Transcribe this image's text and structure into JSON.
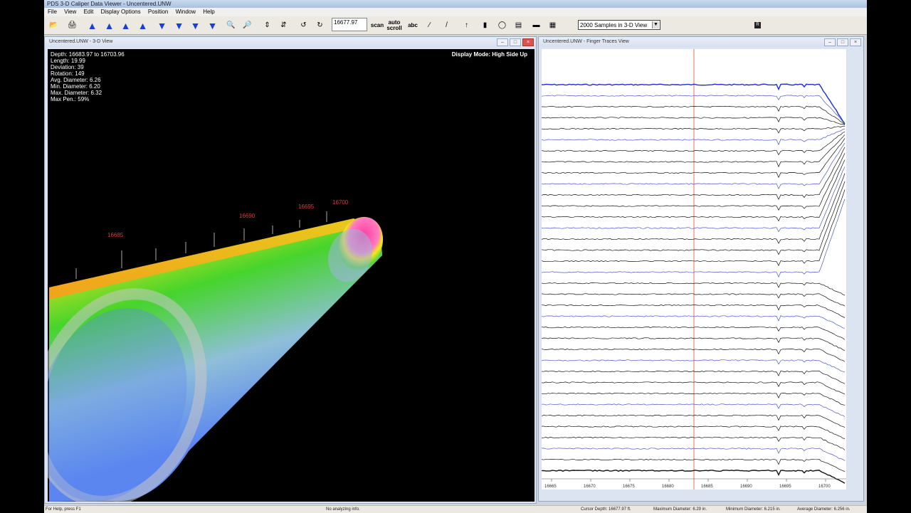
{
  "app": {
    "title": "PDS 3-D Caliper Data Viewer - Uncentered.UNW",
    "menu": [
      "File",
      "View",
      "Edit",
      "Display Options",
      "Position",
      "Window",
      "Help"
    ]
  },
  "toolbar": {
    "depth_value": "16677.97",
    "scan_label": "scan",
    "autoscroll_label": "auto scroll",
    "abc_label": "abc",
    "samples_select": "2000 Samples in 3-D View",
    "r_label": "R"
  },
  "view3d": {
    "title": "Uncentered.UNW - 3-D View",
    "stats": [
      "Depth:  16683.97 to 16703.96",
      "Length:  19.99",
      "Deviation:  39",
      "Rotation:  149",
      "Avg. Diameter:  6.26",
      "Min. Diameter:  6.20",
      "Max. Diameter:  6.32",
      "Max Pen.:  59%"
    ],
    "display_mode": "Display Mode:  High Side Up",
    "depth_labels": [
      "16685",
      "16690",
      "16695",
      "16700"
    ],
    "colors": {
      "low": "#5b86f0",
      "mid": "#46d42c",
      "high": "#f6e619",
      "peak": "#ff3aa0"
    }
  },
  "finger_view": {
    "title": "Uncentered.UNW - Finger Traces View",
    "axis_labels": [
      "16665",
      "16670",
      "16675",
      "16680",
      "16685",
      "16690",
      "16695",
      "16700"
    ],
    "cursor_color": "#e8704a"
  },
  "status": {
    "help": "For Help, press F1",
    "analyzing": "No analyzing info.",
    "cursor_depth": "Cursor Depth:  16677.97 ft.",
    "max_diameter": "Maximum Diameter:  6.29 in.",
    "min_diameter": "Minimum Diameter:  6.215 in.",
    "avg_diameter": "Average Diameter:  6.256 in."
  }
}
